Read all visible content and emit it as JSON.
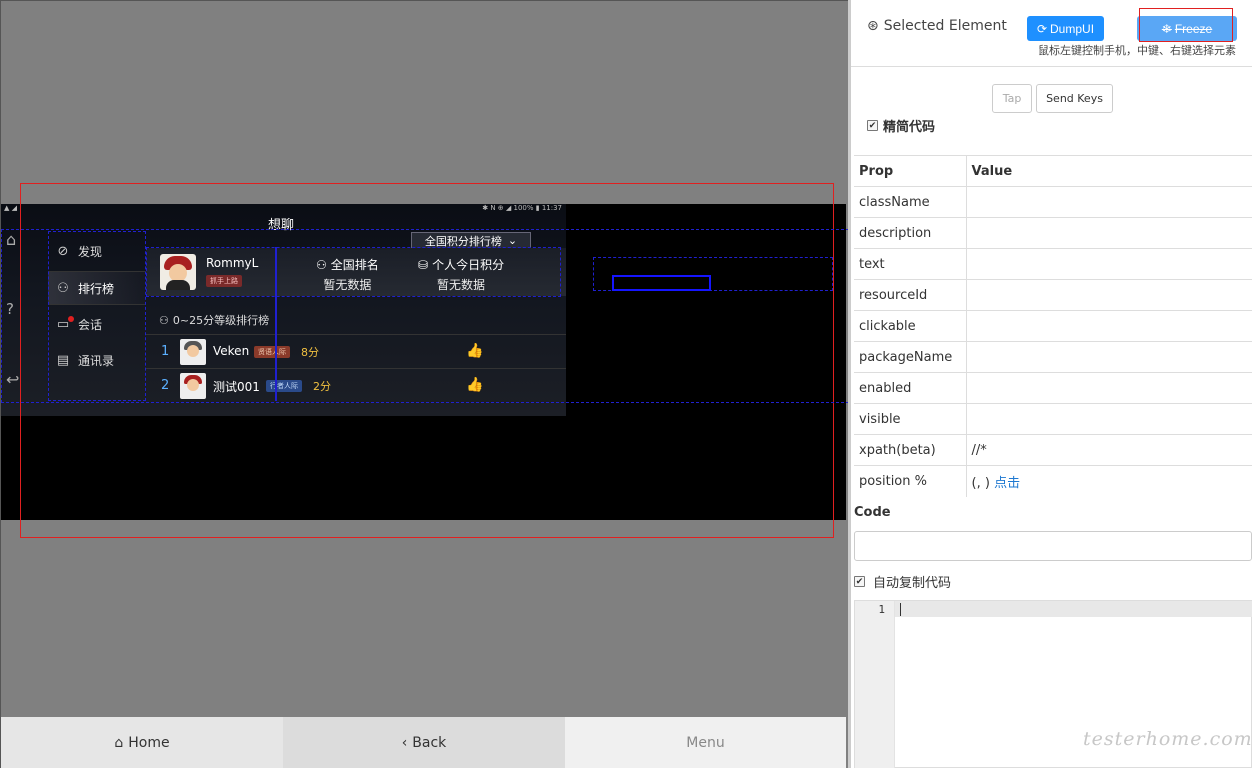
{
  "device": {
    "status_left": "▲ ◢",
    "status_right": "✱ N ⊕ ◢ 100% ▮ 11:37",
    "app_title": "想聊",
    "nav": [
      {
        "label": "发现",
        "icon": "compass-icon"
      },
      {
        "label": "排行榜",
        "icon": "medal-icon"
      },
      {
        "label": "会话",
        "icon": "chat-icon"
      },
      {
        "label": "通讯录",
        "icon": "contacts-icon"
      }
    ],
    "dropdown": "全国积分排行榜",
    "profile": {
      "name": "RommyL",
      "badge": "抓手上路",
      "national_rank_label": "全国排名",
      "national_rank_value": "暂无数据",
      "today_points_label": "个人今日积分",
      "today_points_value": "暂无数据"
    },
    "leaderboard_title": "0~25分等级排行榜",
    "rows": [
      {
        "rank": "1",
        "name": "Veken",
        "level": "贤语人际",
        "score": "8分"
      },
      {
        "rank": "2",
        "name": "测试001",
        "level": "行者人际",
        "score": "2分"
      }
    ]
  },
  "bottom_nav": {
    "home": "Home",
    "back": "Back",
    "menu": "Menu"
  },
  "inspector": {
    "selected_label": "Selected Element",
    "dump_label": "DumpUI",
    "freeze_label": "Freeze",
    "hint": "鼠标左键控制手机，中键、右键选择元素",
    "tap_label": "Tap",
    "send_keys_label": "Send Keys",
    "simplify_label": "精简代码",
    "table_header": {
      "prop": "Prop",
      "value": "Value"
    },
    "props": [
      {
        "key": "className",
        "value": ""
      },
      {
        "key": "description",
        "value": ""
      },
      {
        "key": "text",
        "value": ""
      },
      {
        "key": "resourceId",
        "value": ""
      },
      {
        "key": "clickable",
        "value": ""
      },
      {
        "key": "packageName",
        "value": ""
      },
      {
        "key": "enabled",
        "value": ""
      },
      {
        "key": "visible",
        "value": ""
      },
      {
        "key": "xpath(beta)",
        "value": "//*"
      }
    ],
    "position_label": "position %",
    "position_value": "(, )",
    "position_link": "点击",
    "code_label": "Code",
    "code_value": "",
    "auto_copy_label": "自动复制代码",
    "editor_line": "1",
    "watermark": "testerhome.com"
  },
  "colors": {
    "primary_button": "#1e90ff",
    "freeze_button": "#5aa7f5",
    "highlight_red": "#e02020",
    "highlight_blue": "#1515ff"
  }
}
